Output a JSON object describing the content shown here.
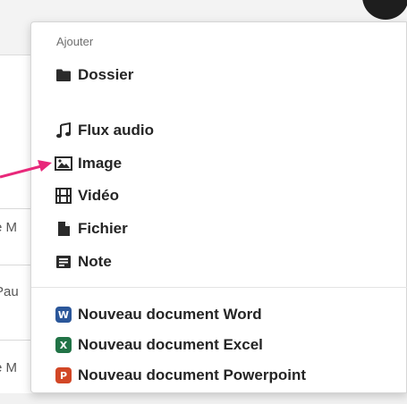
{
  "background": {
    "rows": [
      {
        "text": "e M"
      },
      {
        "text": "Pau"
      },
      {
        "text": "e M"
      }
    ]
  },
  "menu": {
    "header": "Ajouter",
    "items": [
      {
        "label": "Dossier",
        "icon": "folder-icon"
      },
      {
        "label": "Flux audio",
        "icon": "music-note-icon"
      },
      {
        "label": "Image",
        "icon": "image-icon"
      },
      {
        "label": "Vidéo",
        "icon": "film-icon"
      },
      {
        "label": "Fichier",
        "icon": "file-icon"
      },
      {
        "label": "Note",
        "icon": "note-icon"
      }
    ],
    "office_items": [
      {
        "label": "Nouveau document Word",
        "icon": "word-icon",
        "letter": "W",
        "color": "#2b579a"
      },
      {
        "label": "Nouveau document Excel",
        "icon": "excel-icon",
        "letter": "X",
        "color": "#217346"
      },
      {
        "label": "Nouveau document Powerpoint",
        "icon": "powerpoint-icon",
        "letter": "P",
        "color": "#d24726"
      }
    ]
  },
  "colors": {
    "annotation_arrow": "#e8287a",
    "icon": "#2b2b2b"
  }
}
